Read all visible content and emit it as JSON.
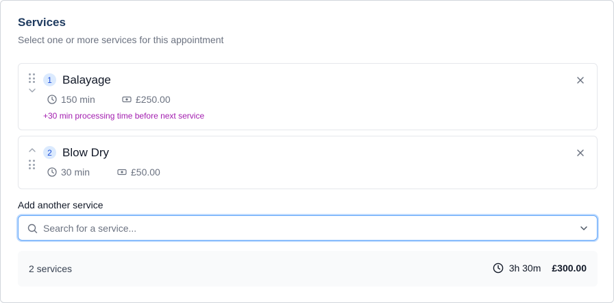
{
  "header": {
    "title": "Services",
    "subtitle": "Select one or more services for this appointment"
  },
  "services": [
    {
      "index": "1",
      "name": "Balayage",
      "duration": "150 min",
      "price": "£250.00",
      "note": "+30 min processing time before next service"
    },
    {
      "index": "2",
      "name": "Blow Dry",
      "duration": "30 min",
      "price": "£50.00"
    }
  ],
  "add_service": {
    "label": "Add another service",
    "placeholder": "Search for a service..."
  },
  "summary": {
    "count": "2 services",
    "total_duration": "3h 30m",
    "total_price": "£300.00"
  },
  "colors": {
    "accent": "#1d4ed8",
    "badge_bg": "#dbeafe",
    "note": "#a21caf",
    "focus": "#60a5fa"
  },
  "icons": [
    "grip-icon",
    "chevron-up-icon",
    "chevron-down-icon",
    "clock-icon",
    "price-tag-icon",
    "close-icon",
    "search-icon"
  ]
}
